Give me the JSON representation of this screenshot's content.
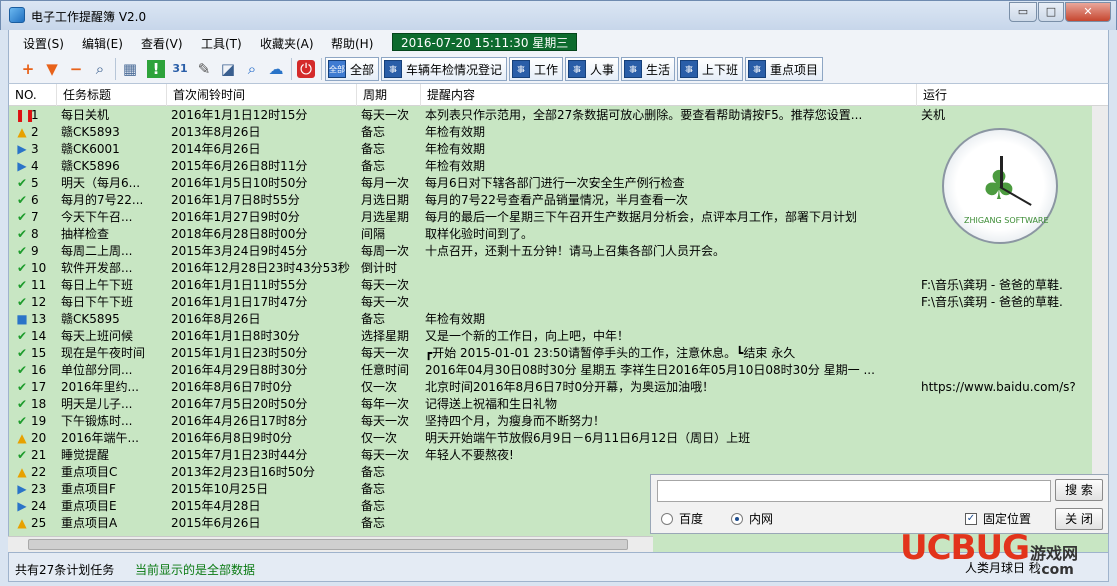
{
  "window": {
    "title": "电子工作提醒簿 V2.0",
    "min": "▭",
    "max": "□",
    "close": "✕"
  },
  "menu": [
    "设置(S)",
    "编辑(E)",
    "查看(V)",
    "工具(T)",
    "收藏夹(A)",
    "帮助(H)"
  ],
  "datetime": "2016-07-20 15:11:30 星期三",
  "toolbar": {
    "icons": [
      "add-icon",
      "expand-icon",
      "remove-icon",
      "search-icon",
      "calendar-icon",
      "alert-icon",
      "calendar31-icon",
      "tools-icon",
      "preview-icon",
      "find-icon",
      "weather-icon",
      "power-icon"
    ],
    "categories": [
      {
        "icon": "全部",
        "label": "全部"
      },
      {
        "icon": "事",
        "label": "车辆年检情况登记"
      },
      {
        "icon": "事",
        "label": "工作"
      },
      {
        "icon": "事",
        "label": "人事"
      },
      {
        "icon": "事",
        "label": "生活"
      },
      {
        "icon": "事",
        "label": "上下班"
      },
      {
        "icon": "事",
        "label": "重点项目"
      }
    ]
  },
  "columns": [
    "NO.",
    "任务标题",
    "首次闹铃时间",
    "周期",
    "提醒内容",
    "运行"
  ],
  "rows": [
    {
      "icon": "pause",
      "no": "1",
      "title": "每日关机",
      "time": "2016年1月1日12时15分",
      "cycle": "每天一次",
      "content": "本列表只作示范用，全部27条数据可放心删除。要查看帮助请按F5。推荐您设置...",
      "run": "关机"
    },
    {
      "icon": "warn",
      "no": "2",
      "title": "赣CK5893",
      "time": "2013年8月26日",
      "cycle": "备忘",
      "content": "年检有效期",
      "run": ""
    },
    {
      "icon": "play",
      "no": "3",
      "title": "赣CK6001",
      "time": "2014年6月26日",
      "cycle": "备忘",
      "content": "年检有效期",
      "run": ""
    },
    {
      "icon": "play",
      "no": "4",
      "title": "赣CK5896",
      "time": "2015年6月26日8时11分",
      "cycle": "备忘",
      "content": "年检有效期",
      "run": ""
    },
    {
      "icon": "check",
      "no": "5",
      "title": "明天（每月6...",
      "time": "2016年1月5日10时50分",
      "cycle": "每月一次",
      "content": "每月6日对下辖各部门进行一次安全生产例行检查",
      "run": ""
    },
    {
      "icon": "check",
      "no": "6",
      "title": "每月的7号22...",
      "time": "2016年1月7日8时55分",
      "cycle": "月选日期",
      "content": "每月的7号22号查看产品销量情况，半月查看一次",
      "run": ""
    },
    {
      "icon": "check",
      "no": "7",
      "title": "今天下午召...",
      "time": "2016年1月27日9时0分",
      "cycle": "月选星期",
      "content": "每月的最后一个星期三下午召开生产数据月分析会，点评本月工作，部署下月计划",
      "run": ""
    },
    {
      "icon": "check",
      "no": "8",
      "title": "抽样检查",
      "time": "2018年6月28日8时00分",
      "cycle": "间隔",
      "content": "取样化验时间到了。",
      "run": ""
    },
    {
      "icon": "check",
      "no": "9",
      "title": "每周二上周...",
      "time": "2015年3月24日9时45分",
      "cycle": "每周一次",
      "content": "十点召开，还剩十五分钟！请马上召集各部门人员开会。",
      "run": ""
    },
    {
      "icon": "check",
      "no": "10",
      "title": "软件开发部...",
      "time": "2016年12月28日23时43分53秒",
      "cycle": "倒计时",
      "content": "",
      "run": ""
    },
    {
      "icon": "check",
      "no": "11",
      "title": "每日上午下班",
      "time": "2016年1月1日11时55分",
      "cycle": "每天一次",
      "content": "",
      "run": "F:\\音乐\\龚玥 - 爸爸的草鞋."
    },
    {
      "icon": "check",
      "no": "12",
      "title": "每日下午下班",
      "time": "2016年1月1日17时47分",
      "cycle": "每天一次",
      "content": "",
      "run": "F:\\音乐\\龚玥 - 爸爸的草鞋."
    },
    {
      "icon": "stop",
      "no": "13",
      "title": "赣CK5895",
      "time": "2016年8月26日",
      "cycle": "备忘",
      "content": "年检有效期",
      "run": ""
    },
    {
      "icon": "check",
      "no": "14",
      "title": "每天上班问候",
      "time": "2016年1月1日8时30分",
      "cycle": "选择星期",
      "content": "又是一个新的工作日，向上吧，中年！",
      "run": ""
    },
    {
      "icon": "check",
      "no": "15",
      "title": "现在是午夜时间",
      "time": "2015年1月1日23时50分",
      "cycle": "每天一次",
      "content": "┏开始 2015-01-01 23:50请暂停手头的工作，注意休息。┗结束 永久",
      "run": ""
    },
    {
      "icon": "check",
      "no": "16",
      "title": "单位部分同...",
      "time": "2016年4月29日8时30分",
      "cycle": "任意时间",
      "content": "2016年04月30日08时30分 星期五 李祥生日2016年05月10日08时30分 星期一 ...",
      "run": ""
    },
    {
      "icon": "check",
      "no": "17",
      "title": "2016年里约...",
      "time": "2016年8月6日7时0分",
      "cycle": "仅一次",
      "content": "北京时间2016年8月6日7时0分开幕，为奥运加油哦！",
      "run": "https://www.baidu.com/s?"
    },
    {
      "icon": "check",
      "no": "18",
      "title": "明天是儿子...",
      "time": "2016年7月5日20时50分",
      "cycle": "每年一次",
      "content": "记得送上祝福和生日礼物",
      "run": ""
    },
    {
      "icon": "check",
      "no": "19",
      "title": "下午锻炼时...",
      "time": "2016年4月26日17时8分",
      "cycle": "每天一次",
      "content": "坚持四个月，为瘦身而不断努力！",
      "run": ""
    },
    {
      "icon": "warn",
      "no": "20",
      "title": "2016年端午...",
      "time": "2016年6月8日9时0分",
      "cycle": "仅一次",
      "content": "明天开始端午节放假6月9日－6月11日6月12日（周日）上班",
      "run": ""
    },
    {
      "icon": "check",
      "no": "21",
      "title": "睡觉提醒",
      "time": "2015年7月1日23时44分",
      "cycle": "每天一次",
      "content": "年轻人不要熬夜!",
      "run": ""
    },
    {
      "icon": "warn",
      "no": "22",
      "title": "重点项目C",
      "time": "2013年2月23日16时50分",
      "cycle": "备忘",
      "content": "",
      "run": ""
    },
    {
      "icon": "play",
      "no": "23",
      "title": "重点项目F",
      "time": "2015年10月25日",
      "cycle": "备忘",
      "content": "",
      "run": ""
    },
    {
      "icon": "play",
      "no": "24",
      "title": "重点项目E",
      "time": "2015年4月28日",
      "cycle": "备忘",
      "content": "",
      "run": ""
    },
    {
      "icon": "warn",
      "no": "25",
      "title": "重点项目A",
      "time": "2015年6月26日",
      "cycle": "备忘",
      "content": "",
      "run": ""
    }
  ],
  "search": {
    "placeholder": "",
    "search_label": "搜 索",
    "close_label": "关 闭",
    "radio1": "百度",
    "radio2": "内网",
    "fixed_label": "固定位置"
  },
  "status": {
    "total": "共有27条计划任务",
    "showing": "当前显示的是全部数据",
    "clock_label": "人类月球日 秒"
  },
  "clock_text": "ZHIGANG SOFTWARE",
  "watermark": {
    "brand": "UCBUG",
    "site": "游戏网",
    "domain": ".com"
  }
}
